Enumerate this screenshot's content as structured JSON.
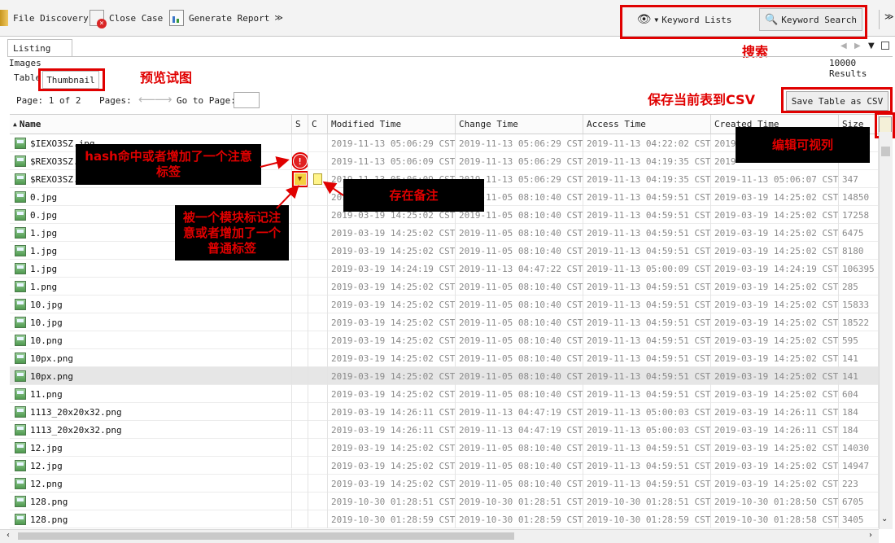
{
  "toolbar": {
    "file_discovery": "File Discovery",
    "close_case": "Close Case",
    "generate_report": "Generate Report",
    "keyword_lists": "Keyword Lists",
    "keyword_search": "Keyword Search"
  },
  "panel": {
    "listing_tab": "Listing",
    "section_label": "Images",
    "results": "10000 Results",
    "table_tab": "Table",
    "thumbnail_tab": "Thumbnail",
    "page_label": "Page:  1 of 2",
    "pages_label": "Pages:",
    "goto_label": "Go to Page:",
    "goto_value": "",
    "save_csv": "Save Table as CSV"
  },
  "annotations": {
    "search": "搜索",
    "thumbnail": "预览试图",
    "save_csv": "保存当前表到CSV",
    "edit_view": "编辑可视列",
    "hash_hit": "hash命中或者增加了一个注意标签",
    "has_note": "存在备注",
    "module_tag": "被一个模块标记注意或者增加了一个普通标签"
  },
  "columns": [
    "Name",
    "S",
    "C",
    "Modified Time",
    "Change Time",
    "Access Time",
    "Created Time",
    "Size"
  ],
  "rows": [
    {
      "name": "$IEXO3SZ.jpg",
      "s": "",
      "c": "",
      "modified": "2019-11-13 05:06:29 CST",
      "change": "2019-11-13 05:06:29 CST",
      "access": "2019-11-13 04:22:02 CST",
      "created": "2019-",
      "size": ""
    },
    {
      "name": "$REXO3SZ.",
      "s": "alert",
      "c": "",
      "modified": "2019-11-13 05:06:09 CST",
      "change": "2019-11-13 05:06:29 CST",
      "access": "2019-11-13 04:19:35 CST",
      "created": "2019-",
      "size": ""
    },
    {
      "name": "$REXO3SZ.",
      "s": "tag",
      "c": "note",
      "modified": "2019-11-13 05:06:09 CST",
      "change": "2019-11-13 05:06:29 CST",
      "access": "2019-11-13 04:19:35 CST",
      "created": "2019-11-13 05:06:07 CST",
      "size": "347"
    },
    {
      "name": "0.jpg",
      "s": "",
      "c": "",
      "modified": "2019-03-19 14:25:02 CST",
      "change": "2019-11-05 08:10:40 CST",
      "access": "2019-11-13 04:59:51 CST",
      "created": "2019-03-19 14:25:02 CST",
      "size": "14850"
    },
    {
      "name": "0.jpg",
      "s": "",
      "c": "",
      "modified": "2019-03-19 14:25:02 CST",
      "change": "2019-11-05 08:10:40 CST",
      "access": "2019-11-13 04:59:51 CST",
      "created": "2019-03-19 14:25:02 CST",
      "size": "17258"
    },
    {
      "name": "1.jpg",
      "s": "",
      "c": "",
      "modified": "2019-03-19 14:25:02 CST",
      "change": "2019-11-05 08:10:40 CST",
      "access": "2019-11-13 04:59:51 CST",
      "created": "2019-03-19 14:25:02 CST",
      "size": "6475"
    },
    {
      "name": "1.jpg",
      "s": "",
      "c": "",
      "modified": "2019-03-19 14:25:02 CST",
      "change": "2019-11-05 08:10:40 CST",
      "access": "2019-11-13 04:59:51 CST",
      "created": "2019-03-19 14:25:02 CST",
      "size": "8180"
    },
    {
      "name": "1.jpg",
      "s": "",
      "c": "",
      "modified": "2019-03-19 14:24:19 CST",
      "change": "2019-11-13 04:47:22 CST",
      "access": "2019-11-13 05:00:09 CST",
      "created": "2019-03-19 14:24:19 CST",
      "size": "106395"
    },
    {
      "name": "1.png",
      "s": "",
      "c": "",
      "modified": "2019-03-19 14:25:02 CST",
      "change": "2019-11-05 08:10:40 CST",
      "access": "2019-11-13 04:59:51 CST",
      "created": "2019-03-19 14:25:02 CST",
      "size": "285"
    },
    {
      "name": "10.jpg",
      "s": "",
      "c": "",
      "modified": "2019-03-19 14:25:02 CST",
      "change": "2019-11-05 08:10:40 CST",
      "access": "2019-11-13 04:59:51 CST",
      "created": "2019-03-19 14:25:02 CST",
      "size": "15833"
    },
    {
      "name": "10.jpg",
      "s": "",
      "c": "",
      "modified": "2019-03-19 14:25:02 CST",
      "change": "2019-11-05 08:10:40 CST",
      "access": "2019-11-13 04:59:51 CST",
      "created": "2019-03-19 14:25:02 CST",
      "size": "18522"
    },
    {
      "name": "10.png",
      "s": "",
      "c": "",
      "modified": "2019-03-19 14:25:02 CST",
      "change": "2019-11-05 08:10:40 CST",
      "access": "2019-11-13 04:59:51 CST",
      "created": "2019-03-19 14:25:02 CST",
      "size": "595"
    },
    {
      "name": "10px.png",
      "s": "",
      "c": "",
      "modified": "2019-03-19 14:25:02 CST",
      "change": "2019-11-05 08:10:40 CST",
      "access": "2019-11-13 04:59:51 CST",
      "created": "2019-03-19 14:25:02 CST",
      "size": "141"
    },
    {
      "name": "10px.png",
      "s": "",
      "c": "",
      "modified": "2019-03-19 14:25:02 CST",
      "change": "2019-11-05 08:10:40 CST",
      "access": "2019-11-13 04:59:51 CST",
      "created": "2019-03-19 14:25:02 CST",
      "size": "141",
      "selected": true
    },
    {
      "name": "11.png",
      "s": "",
      "c": "",
      "modified": "2019-03-19 14:25:02 CST",
      "change": "2019-11-05 08:10:40 CST",
      "access": "2019-11-13 04:59:51 CST",
      "created": "2019-03-19 14:25:02 CST",
      "size": "604"
    },
    {
      "name": "1113_20x20x32.png",
      "s": "",
      "c": "",
      "modified": "2019-03-19 14:26:11 CST",
      "change": "2019-11-13 04:47:19 CST",
      "access": "2019-11-13 05:00:03 CST",
      "created": "2019-03-19 14:26:11 CST",
      "size": "184"
    },
    {
      "name": "1113_20x20x32.png",
      "s": "",
      "c": "",
      "modified": "2019-03-19 14:26:11 CST",
      "change": "2019-11-13 04:47:19 CST",
      "access": "2019-11-13 05:00:03 CST",
      "created": "2019-03-19 14:26:11 CST",
      "size": "184"
    },
    {
      "name": "12.jpg",
      "s": "",
      "c": "",
      "modified": "2019-03-19 14:25:02 CST",
      "change": "2019-11-05 08:10:40 CST",
      "access": "2019-11-13 04:59:51 CST",
      "created": "2019-03-19 14:25:02 CST",
      "size": "14030"
    },
    {
      "name": "12.jpg",
      "s": "",
      "c": "",
      "modified": "2019-03-19 14:25:02 CST",
      "change": "2019-11-05 08:10:40 CST",
      "access": "2019-11-13 04:59:51 CST",
      "created": "2019-03-19 14:25:02 CST",
      "size": "14947"
    },
    {
      "name": "12.png",
      "s": "",
      "c": "",
      "modified": "2019-03-19 14:25:02 CST",
      "change": "2019-11-05 08:10:40 CST",
      "access": "2019-11-13 04:59:51 CST",
      "created": "2019-03-19 14:25:02 CST",
      "size": "223"
    },
    {
      "name": "128.png",
      "s": "",
      "c": "",
      "modified": "2019-10-30 01:28:51 CST",
      "change": "2019-10-30 01:28:51 CST",
      "access": "2019-10-30 01:28:51 CST",
      "created": "2019-10-30 01:28:50 CST",
      "size": "6705"
    },
    {
      "name": "128.png",
      "s": "",
      "c": "",
      "modified": "2019-10-30 01:28:59 CST",
      "change": "2019-10-30 01:28:59 CST",
      "access": "2019-10-30 01:28:59 CST",
      "created": "2019-10-30 01:28:58 CST",
      "size": "3405"
    }
  ]
}
